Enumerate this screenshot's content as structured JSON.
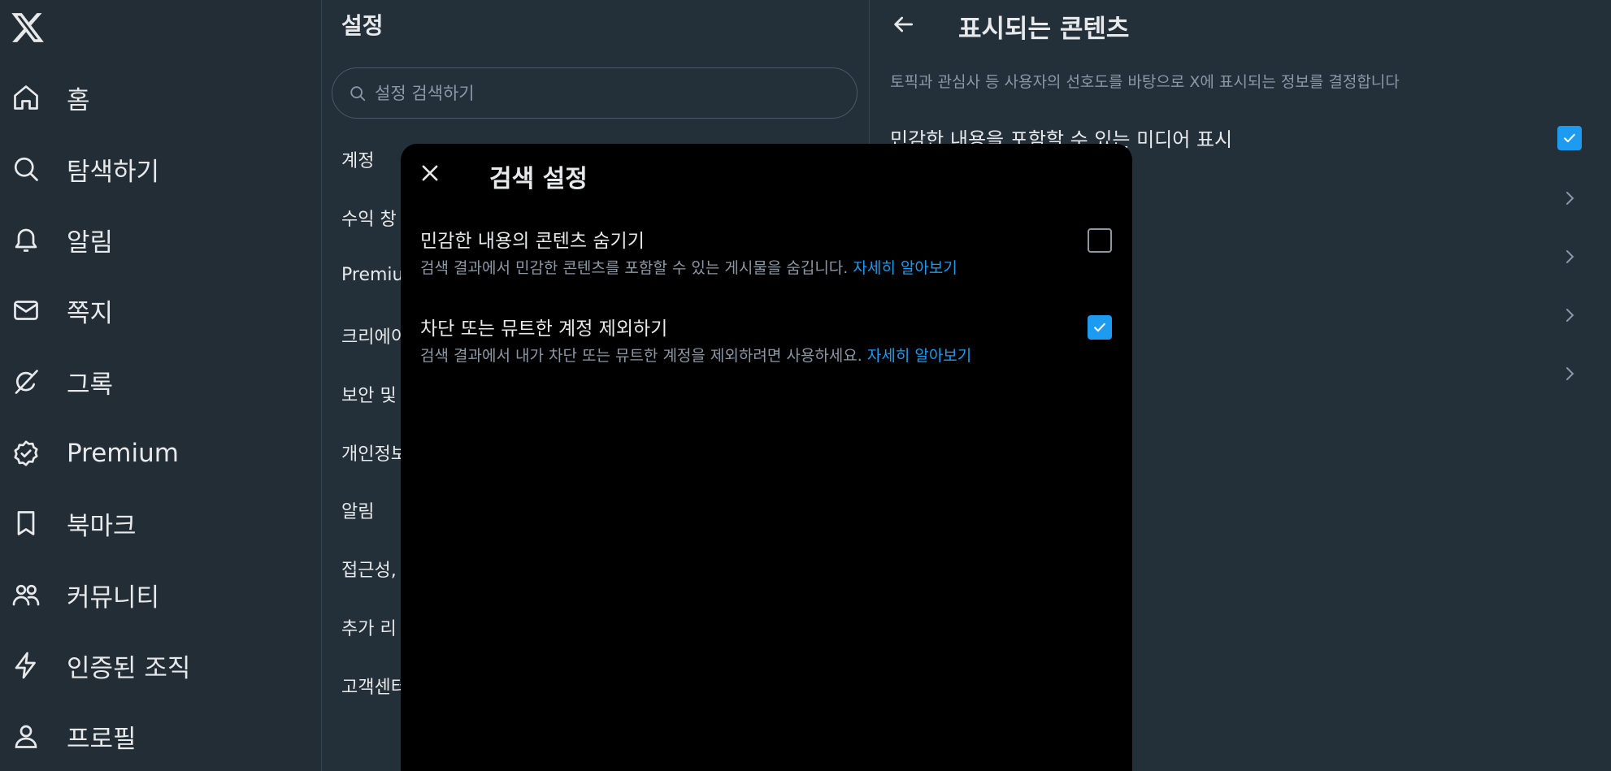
{
  "nav": {
    "items": [
      {
        "label": "홈",
        "icon": "home-icon"
      },
      {
        "label": "탐색하기",
        "icon": "search-icon"
      },
      {
        "label": "알림",
        "icon": "bell-icon"
      },
      {
        "label": "쪽지",
        "icon": "mail-icon"
      },
      {
        "label": "그록",
        "icon": "grok-icon"
      },
      {
        "label": "Premium",
        "icon": "verified-badge-icon"
      },
      {
        "label": "북마크",
        "icon": "bookmark-icon"
      },
      {
        "label": "커뮤니티",
        "icon": "people-icon"
      },
      {
        "label": "인증된 조직",
        "icon": "lightning-icon"
      },
      {
        "label": "프로필",
        "icon": "person-icon"
      }
    ]
  },
  "settings": {
    "title": "설정",
    "search_placeholder": "설정 검색하기",
    "items": [
      "계정",
      "수익 창",
      "Premiu",
      "크리에이",
      "보안 및",
      "개인정보",
      "알림",
      "접근성,",
      "추가 리",
      "고객센터"
    ]
  },
  "detail": {
    "title": "표시되는 콘텐츠",
    "description": "토픽과 관심사 등 사용자의 선호도를 바탕으로 X에 표시되는 정보를 결정합니다",
    "row_label": "민감한 내용을 포함할 수 있는 미디어 표시",
    "row_checked": true
  },
  "modal": {
    "title": "검색 설정",
    "options": [
      {
        "label": "민감한 내용의 콘텐츠 숨기기",
        "desc": "검색 결과에서 민감한 콘텐츠를 포함할 수 있는 게시물을 숨깁니다.",
        "link": "자세히 알아보기",
        "checked": false
      },
      {
        "label": "차단 또는 뮤트한 계정 제외하기",
        "desc": "검색 결과에서 내가 차단 또는 뮤트한 계정을 제외하려면 사용하세요.",
        "link": "자세히 알아보기",
        "checked": true
      }
    ]
  },
  "colors": {
    "accent": "#1d9bf0",
    "background": "#243039",
    "modal_bg": "#000000",
    "muted_text": "#8b98a5"
  }
}
